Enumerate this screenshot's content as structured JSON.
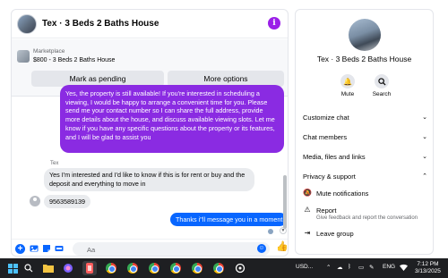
{
  "chat": {
    "title": "Tex · 3 Beds 2 Baths House",
    "info_symbol": "i",
    "listing": {
      "category": "Marketplace",
      "price_title": "$800 - 3 Beds 2 Baths House",
      "mark_pending_label": "Mark as pending",
      "more_options_label": "More options"
    },
    "messages": {
      "outgoing_1": "Yes, the property is still available! If you're interested in scheduling a viewing, I would be happy to arrange a convenient time for you. Please send me your contact number so I can share the full address, provide more details about the house, and discuss available viewing slots. Let me know if you have any specific questions about the property or its features, and I will be glad to assist you",
      "sender_name": "Tex",
      "incoming_1": "Yes I'm interested and I'd like to know if this is for rent or buy and the deposit and everything to move in",
      "incoming_2": "9563589139",
      "outgoing_2": "Thanks i''ll message you in a moment"
    },
    "composer": {
      "placeholder": "Aa"
    }
  },
  "info_panel": {
    "name": "Tex · 3 Beds 2 Baths House",
    "actions": {
      "mute": "Mute",
      "search": "Search"
    },
    "sections": {
      "customize_chat": "Customize chat",
      "chat_members": "Chat members",
      "media_files_links": "Media, files and links",
      "privacy_support": "Privacy & support"
    },
    "privacy_items": {
      "mute_notifications": "Mute notifications",
      "report": "Report",
      "report_desc": "Give feedback and report the conversation",
      "leave_group": "Leave group"
    }
  },
  "taskbar": {
    "tray_label": "USD...",
    "language": "ENG",
    "time": "7:12 PM",
    "date": "3/13/2025"
  },
  "colors": {
    "messenger_purple": "#8a2be2",
    "messenger_blue": "#0866ff",
    "bubble_gray": "#e9ebee"
  }
}
